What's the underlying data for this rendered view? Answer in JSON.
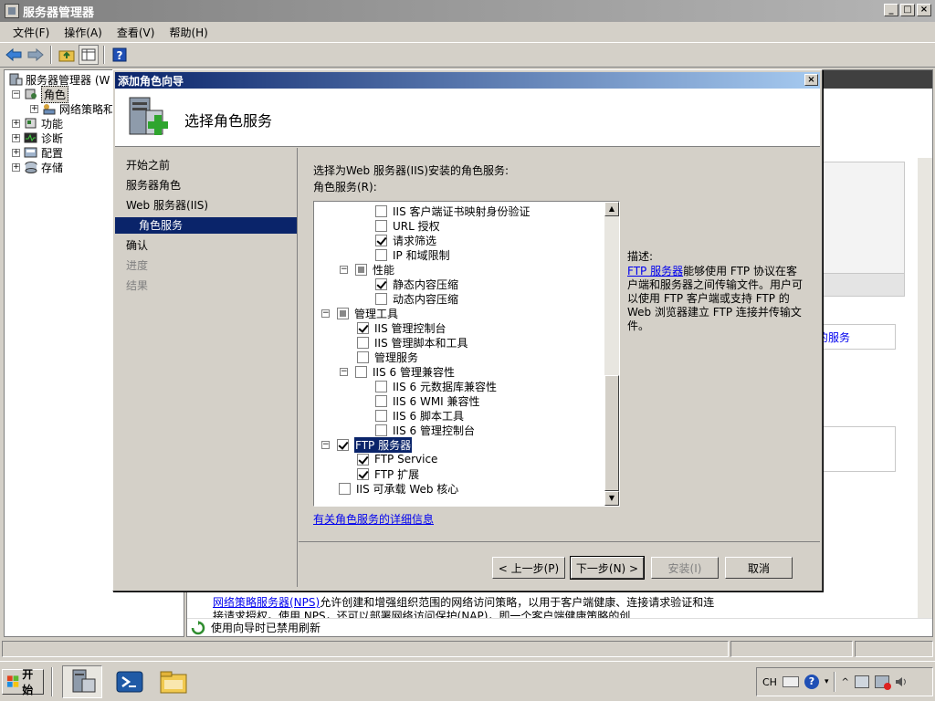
{
  "window": {
    "title": "服务器管理器"
  },
  "menu": [
    "文件(F)",
    "操作(A)",
    "查看(V)",
    "帮助(H)"
  ],
  "tree": {
    "root": "服务器管理器 (W",
    "items": [
      {
        "label": "角色",
        "expanded": true,
        "selected": true
      },
      {
        "label": "网络策略和",
        "child": true
      },
      {
        "label": "功能"
      },
      {
        "label": "诊断"
      },
      {
        "label": "配置"
      },
      {
        "label": "存储"
      }
    ]
  },
  "background": {
    "partial_link": "的服务",
    "desc_link": "网络策略服务器(NPS)",
    "desc_text": "允许创建和增强组织范围的网络访问策略，以用于客户端健康、连接请求验证和连接请求授权。使用 NPS，还可以部署网络访问保护(NAP)，即一个客户端健康策略的创",
    "status": "使用向导时已禁用刷新"
  },
  "dialog": {
    "title": "添加角色向导",
    "heading": "选择角色服务",
    "nav": [
      {
        "label": "开始之前",
        "state": "normal"
      },
      {
        "label": "服务器角色",
        "state": "normal"
      },
      {
        "label": "Web 服务器(IIS)",
        "state": "normal"
      },
      {
        "label": "角色服务",
        "state": "active"
      },
      {
        "label": "确认",
        "state": "normal"
      },
      {
        "label": "进度",
        "state": "disabled"
      },
      {
        "label": "结果",
        "state": "disabled"
      }
    ],
    "instruction": "选择为Web 服务器(IIS)安装的角色服务:",
    "list_label": "角色服务(R):",
    "services": [
      {
        "label": "IIS 客户端证书映射身份验证",
        "level": 3,
        "check": "unchecked",
        "expander": ""
      },
      {
        "label": "URL 授权",
        "level": 3,
        "check": "unchecked",
        "expander": ""
      },
      {
        "label": "请求筛选",
        "level": 3,
        "check": "checked",
        "expander": ""
      },
      {
        "label": "IP 和域限制",
        "level": 3,
        "check": "unchecked",
        "expander": ""
      },
      {
        "label": "性能",
        "level": 2,
        "check": "partial",
        "expander": "−"
      },
      {
        "label": "静态内容压缩",
        "level": 3,
        "check": "checked",
        "expander": ""
      },
      {
        "label": "动态内容压缩",
        "level": 3,
        "check": "unchecked",
        "expander": ""
      },
      {
        "label": "管理工具",
        "level": 1,
        "check": "partial",
        "expander": "−"
      },
      {
        "label": "IIS 管理控制台",
        "level": 2,
        "check": "checked",
        "expander": ""
      },
      {
        "label": "IIS 管理脚本和工具",
        "level": 2,
        "check": "unchecked",
        "expander": ""
      },
      {
        "label": "管理服务",
        "level": 2,
        "check": "unchecked",
        "expander": ""
      },
      {
        "label": "IIS 6 管理兼容性",
        "level": 2,
        "check": "unchecked",
        "expander": "−"
      },
      {
        "label": "IIS 6 元数据库兼容性",
        "level": 3,
        "check": "unchecked",
        "expander": ""
      },
      {
        "label": "IIS 6 WMI 兼容性",
        "level": 3,
        "check": "unchecked",
        "expander": ""
      },
      {
        "label": "IIS 6 脚本工具",
        "level": 3,
        "check": "unchecked",
        "expander": ""
      },
      {
        "label": "IIS 6 管理控制台",
        "level": 3,
        "check": "unchecked",
        "expander": ""
      },
      {
        "label": "FTP 服务器",
        "level": 1,
        "check": "checked",
        "expander": "−",
        "selected": true
      },
      {
        "label": "FTP Service",
        "level": 2,
        "check": "checked",
        "expander": ""
      },
      {
        "label": "FTP 扩展",
        "level": 2,
        "check": "checked",
        "expander": ""
      },
      {
        "label": "IIS 可承载 Web 核心",
        "level": 1,
        "check": "unchecked",
        "expander": ""
      }
    ],
    "description_title": "描述:",
    "description_link": "FTP 服务器",
    "description_text": "能够使用 FTP 协议在客户端和服务器之间传输文件。用户可以使用 FTP 客户端或支持 FTP 的 Web 浏览器建立 FTP 连接并传输文件。",
    "more_info": "有关角色服务的详细信息",
    "buttons": {
      "back": "< 上一步(P)",
      "next": "下一步(N) >",
      "install": "安装(I)",
      "cancel": "取消"
    }
  },
  "taskbar": {
    "start": "开始",
    "lang": "CH"
  }
}
